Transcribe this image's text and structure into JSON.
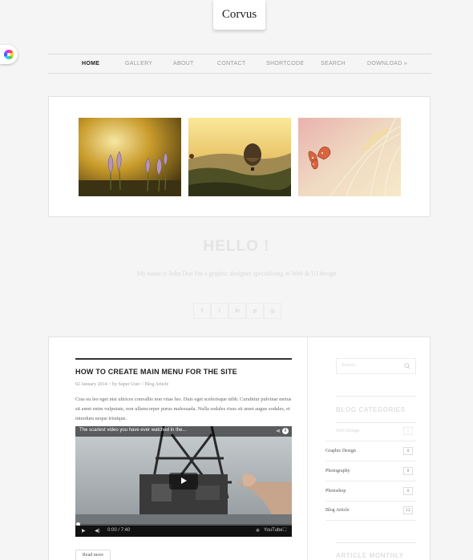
{
  "site": {
    "logo": "Corvus"
  },
  "nav": {
    "items": [
      {
        "label": "HOME",
        "active": true
      },
      {
        "label": "GALLERY",
        "active": false
      },
      {
        "label": "ABOUT",
        "active": false
      },
      {
        "label": "CONTACT",
        "active": false
      },
      {
        "label": "SHORTCODE",
        "active": false
      },
      {
        "label": "SEARCH",
        "active": false
      },
      {
        "label": "DOWNLOAD »",
        "active": false
      }
    ]
  },
  "slider": {
    "slides": [
      "crocus-flowers",
      "hot-air-balloon",
      "butterfly-on-wheat"
    ]
  },
  "hero": {
    "heading": "HELLO !",
    "intro": "My name is John Doe I'm a graphic designer specialising in Web & UI design"
  },
  "socials": [
    {
      "icon": "facebook-icon",
      "glyph": "f"
    },
    {
      "icon": "twitter-icon",
      "glyph": "t"
    },
    {
      "icon": "linkedin-icon",
      "glyph": "in"
    },
    {
      "icon": "pinterest-icon",
      "glyph": "p"
    },
    {
      "icon": "dribbble-icon",
      "glyph": "◎"
    }
  ],
  "post": {
    "title": "HOW TO CREATE MAIN MENU FOR THE SITE",
    "date": "02 January 2014",
    "by": "by Super User",
    "category": "Blog Article",
    "excerpt": "Cras eu leo eget nisi ultrices convallis non vitae leo. Duis eget scelerisque nibh. Curabitur pulvinar metus sit amet enim vulputate, non ullamcorper purus malesuada. Nulla sodales risus sit amet augue sodales, et interdum neque tristique.",
    "read_more": "Read more",
    "video": {
      "title": "The scariest video you have ever watched in the...",
      "time": "0:00 / 7:40",
      "brand": "YouTube"
    }
  },
  "sidebar": {
    "search_placeholder": "Search...",
    "categories_heading": "BLOG CATEGORIES",
    "categories": [
      {
        "name": "Web Design",
        "count": "1",
        "faded": true
      },
      {
        "name": "Graphic Design",
        "count": "0",
        "faded": false
      },
      {
        "name": "Photography",
        "count": "0",
        "faded": false
      },
      {
        "name": "Photoshop",
        "count": "0",
        "faded": false
      },
      {
        "name": "Blog Article",
        "count": "12",
        "faded": false
      }
    ],
    "monthly_heading": "ARTICLE MONTHLY"
  }
}
